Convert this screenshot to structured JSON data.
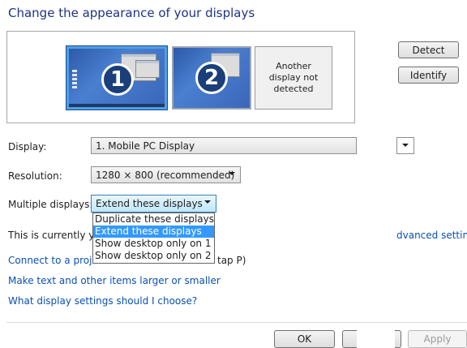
{
  "title": "Change the appearance of your displays",
  "preview": {
    "monitor1_number": "1",
    "monitor2_number": "2",
    "not_detected_text": "Another display not detected"
  },
  "buttons": {
    "detect": "Detect",
    "identify": "Identify",
    "ok": "OK",
    "apply": "Apply"
  },
  "display": {
    "label": "Display:",
    "value": "1. Mobile PC Display"
  },
  "resolution": {
    "label": "Resolution:",
    "value": "1280 × 800 (recommended)"
  },
  "multiple": {
    "label": "Multiple displays:",
    "value": "Extend these displays",
    "options": [
      "Duplicate these displays",
      "Extend these displays",
      "Show desktop only on 1",
      "Show desktop only on 2"
    ],
    "selected_index": 1
  },
  "status_text": "This is currently you",
  "advanced_link": "dvanced settings",
  "links": {
    "connect_start": "Connect to a projec",
    "connect_end": "tap P)",
    "text_size": "Make text and other items larger or smaller",
    "help": "What display settings should I choose?"
  },
  "colors": {
    "title": "#1e3287",
    "link": "#0a50b4",
    "selection": "#3399ff"
  }
}
